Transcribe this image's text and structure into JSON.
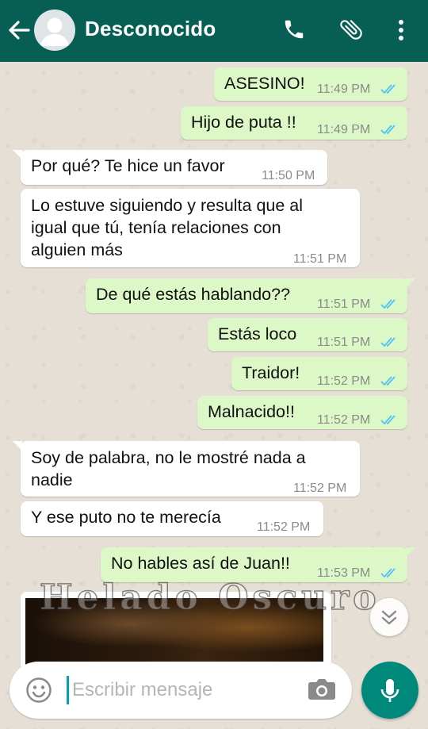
{
  "header": {
    "contact_name": "Desconocido"
  },
  "messages": [
    {
      "id": "m1",
      "dir": "out",
      "text": "ASESINO!",
      "time": "11:49 PM"
    },
    {
      "id": "m2",
      "dir": "out",
      "text": "Hijo de puta !!",
      "time": "11:49 PM"
    },
    {
      "id": "m3",
      "dir": "in",
      "text": "Por qué? Te hice un favor",
      "time": "11:50 PM"
    },
    {
      "id": "m4",
      "dir": "in",
      "text": "Lo estuve siguiendo y resulta que al igual que tú, tenía relaciones con alguien más",
      "time": "11:51 PM"
    },
    {
      "id": "m5",
      "dir": "out",
      "text": "De qué estás hablando??",
      "time": "11:51 PM"
    },
    {
      "id": "m6",
      "dir": "out",
      "text": "Estás loco",
      "time": "11:51 PM"
    },
    {
      "id": "m7",
      "dir": "out",
      "text": "Traidor!",
      "time": "11:52 PM"
    },
    {
      "id": "m8",
      "dir": "out",
      "text": "Malnacido!!",
      "time": "11:52 PM"
    },
    {
      "id": "m9",
      "dir": "in",
      "text": "Soy de palabra, no le mostré nada a nadie",
      "time": "11:52 PM"
    },
    {
      "id": "m10",
      "dir": "in",
      "text": "Y ese puto no te merecía",
      "time": "11:52 PM"
    },
    {
      "id": "m11",
      "dir": "out",
      "text": "No hables así de Juan!!",
      "time": "11:53 PM"
    }
  ],
  "watermark": "Helado Oscuro",
  "composer": {
    "placeholder": "Escribir mensaje"
  },
  "colors": {
    "header_bg": "#075e54",
    "outgoing_bubble": "#dcf8c6",
    "incoming_bubble": "#ffffff",
    "read_ticks": "#4fc3f7",
    "mic_button": "#00897b"
  },
  "icons": [
    "back-arrow-icon",
    "avatar-placeholder-icon",
    "phone-icon",
    "paperclip-icon",
    "more-vert-icon",
    "double-check-icon",
    "chevron-double-down-icon",
    "emoji-icon",
    "camera-icon",
    "mic-icon"
  ]
}
